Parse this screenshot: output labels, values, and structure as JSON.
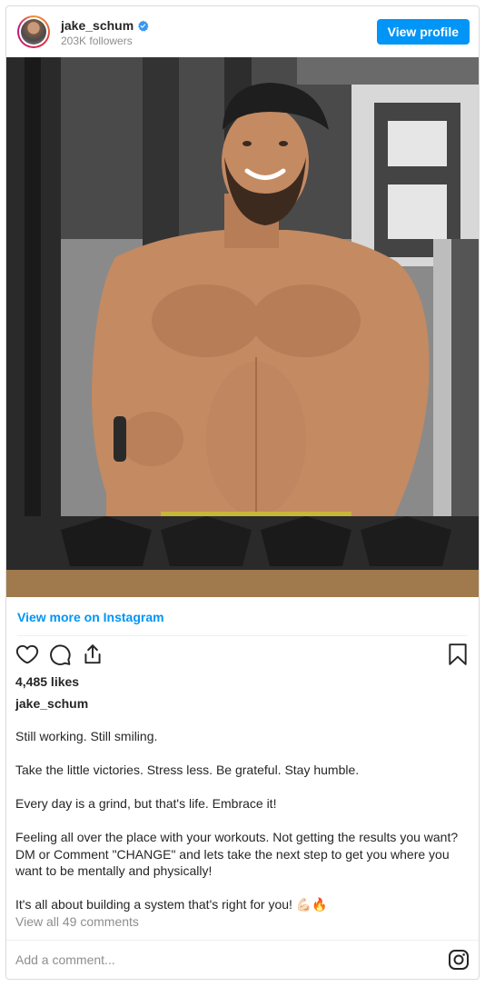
{
  "header": {
    "username": "jake_schum",
    "followers": "203K followers",
    "view_profile_label": "View profile"
  },
  "icons": {
    "verified": "verified-badge-icon",
    "like": "heart-icon",
    "comment": "comment-icon",
    "share": "share-icon",
    "save": "bookmark-icon",
    "instagram": "instagram-icon"
  },
  "colors": {
    "accent": "#0095f6",
    "muted": "#8e8e8e",
    "text": "#262626"
  },
  "view_more_label": "View more on Instagram",
  "likes": "4,485 likes",
  "caption_username": "jake_schum",
  "caption_lines": [
    "Still working. Still smiling.",
    "Take the little victories. Stress less. Be grateful. Stay humble.",
    "Every day is a grind, but that's life. Embrace it!",
    "Feeling all over the place with your workouts. Not getting the results you want? DM or Comment \"CHANGE\" and lets take the next step to get you where you want to be mentally and physically!",
    "It's all about building a system that's right for you! 💪🏻🔥"
  ],
  "view_comments_label": "View all 49 comments",
  "comment_placeholder": "Add a comment..."
}
